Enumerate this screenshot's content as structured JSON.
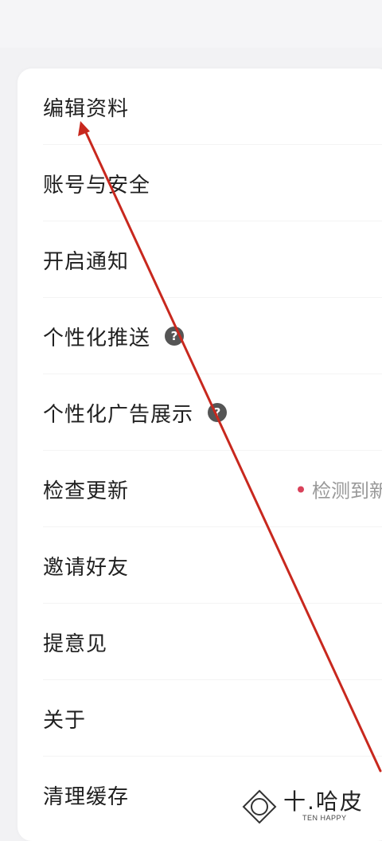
{
  "settings": {
    "items": [
      {
        "label": "编辑资料"
      },
      {
        "label": "账号与安全"
      },
      {
        "label": "开启通知"
      },
      {
        "label": "个性化推送",
        "help_icon": "question-circle-icon"
      },
      {
        "label": "个性化广告展示",
        "help_icon": "question-circle-icon"
      },
      {
        "label": "检查更新",
        "status": "检测到新"
      },
      {
        "label": "邀请好友"
      },
      {
        "label": "提意见"
      },
      {
        "label": "关于"
      },
      {
        "label": "清理缓存"
      }
    ]
  },
  "annotation": {
    "arrow_color": "#c8281e"
  },
  "watermark": {
    "title": "十.哈皮",
    "subtitle": "TEN HAPPY",
    "icon": "diamond-circle-logo-icon"
  },
  "colors": {
    "status_dot": "#d9415a",
    "help_icon_bg": "#555555"
  }
}
